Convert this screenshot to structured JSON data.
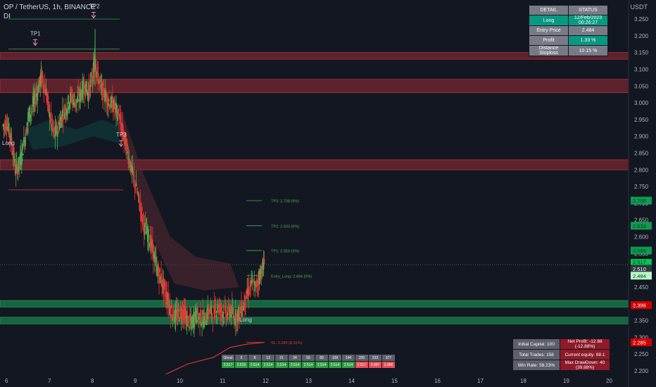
{
  "header": {
    "symbol": "OP / TetherUS, 1h, BINANCE",
    "indicator": "DI"
  },
  "axis_currency": "USDT",
  "price_ticks": [
    "3.250",
    "3.200",
    "3.150",
    "3.100",
    "3.050",
    "3.000",
    "2.950",
    "2.900",
    "2.850",
    "2.800",
    "2.750",
    "2.700",
    "2.650",
    "2.600",
    "2.550",
    "2.500",
    "2.450",
    "2.400",
    "2.350",
    "2.300",
    "2.250",
    "2.200"
  ],
  "time_ticks": [
    "6",
    "7",
    "8",
    "9",
    "10",
    "11",
    "12",
    "13",
    "14",
    "15",
    "16",
    "17",
    "18",
    "19",
    "20"
  ],
  "price_badges": {
    "tp3": "2.708",
    "tp2": "2.633",
    "tp1": "2.559",
    "last": "2.517",
    "last_sub": "33:55",
    "mid": "2.510",
    "entry": "2.484",
    "red": "2.396",
    "sl": "2.285"
  },
  "colors": {
    "bg": "#131722",
    "bull": "#4caf50",
    "bear": "#e53935",
    "bright_green": "#00e676",
    "red_zone": "#9c2b36",
    "green_zone": "#1b8f53",
    "accent_green": "#089981"
  },
  "annotations": {
    "tp1_marker": "TP1",
    "tp2_marker": "TP2",
    "tp3_marker": "TP3",
    "long_left": "Long",
    "long_right": "Long"
  },
  "levels": {
    "tp3_label": "TP3: 2.708 (9%)",
    "tp2_label": "TP2: 2.633 (6%)",
    "tp1_label": "TP1: 2.559 (3%)",
    "entry_label": "Entry_Long: 2.484 (0%)",
    "sl_label": "SL: 2.285 (8.01%)"
  },
  "status_table": {
    "col1": "DETAIL",
    "col2": "STATUS",
    "rows": [
      {
        "k": "Long",
        "v": "12/Feb/2023 00:26:27"
      },
      {
        "k": "Entry Price",
        "v": "2.484"
      },
      {
        "k": "Profit",
        "v": "1.33 %"
      },
      {
        "k": "Distance Stoploss",
        "v": "10.15 %"
      }
    ]
  },
  "fib_table": {
    "head": [
      "Ghost",
      "5",
      "8",
      "13",
      "21",
      "34",
      "55",
      "89",
      "109",
      "144",
      "200",
      "233",
      "377"
    ],
    "vals": [
      "2.517",
      "2.515",
      "2.514",
      "2.514",
      "2.514",
      "2.514",
      "2.514",
      "2.514",
      "2.514",
      "2.514",
      "2.517",
      "2.487",
      "2.486"
    ]
  },
  "stats_table": {
    "initial_capital": "Initial Capital: 100",
    "net_profit": "Net Profit: -12.88 (-12.88%)",
    "total_trades": "Total Trades: 158",
    "current_equity": "Current equity: 88.1",
    "win_rate": "Win Rate: 58.23%",
    "max_drawdown": "Max DrawDown: 40 (39.88%)"
  },
  "chart_data": {
    "type": "candlestick",
    "title": "OP / TetherUS, 1h, BINANCE",
    "ylim": [
      2.2,
      3.29
    ],
    "xlim": [
      5.85,
      20.6
    ],
    "close_path": [
      [
        5.9,
        2.93
      ],
      [
        6.0,
        2.94
      ],
      [
        6.1,
        2.89
      ],
      [
        6.2,
        2.8
      ],
      [
        6.3,
        2.82
      ],
      [
        6.4,
        2.88
      ],
      [
        6.5,
        2.96
      ],
      [
        6.6,
        2.99
      ],
      [
        6.7,
        3.03
      ],
      [
        6.8,
        3.08
      ],
      [
        6.9,
        3.04
      ],
      [
        7.0,
        2.96
      ],
      [
        7.1,
        2.9
      ],
      [
        7.2,
        2.93
      ],
      [
        7.3,
        2.97
      ],
      [
        7.4,
        2.99
      ],
      [
        7.5,
        3.02
      ],
      [
        7.6,
        3.0
      ],
      [
        7.7,
        3.02
      ],
      [
        7.8,
        3.05
      ],
      [
        7.9,
        3.03
      ],
      [
        8.0,
        3.08
      ],
      [
        8.05,
        3.13
      ],
      [
        8.1,
        3.09
      ],
      [
        8.2,
        3.04
      ],
      [
        8.3,
        3.02
      ],
      [
        8.4,
        3.0
      ],
      [
        8.5,
        2.99
      ],
      [
        8.6,
        2.96
      ],
      [
        8.7,
        2.91
      ],
      [
        8.8,
        2.86
      ],
      [
        8.9,
        2.8
      ],
      [
        9.0,
        2.75
      ],
      [
        9.1,
        2.69
      ],
      [
        9.2,
        2.63
      ],
      [
        9.3,
        2.6
      ],
      [
        9.4,
        2.56
      ],
      [
        9.5,
        2.5
      ],
      [
        9.6,
        2.47
      ],
      [
        9.7,
        2.43
      ],
      [
        9.8,
        2.39
      ],
      [
        9.9,
        2.36
      ],
      [
        10.0,
        2.37
      ],
      [
        10.1,
        2.38
      ],
      [
        10.2,
        2.35
      ],
      [
        10.3,
        2.34
      ],
      [
        10.4,
        2.37
      ],
      [
        10.5,
        2.36
      ],
      [
        10.6,
        2.35
      ],
      [
        10.7,
        2.38
      ],
      [
        10.8,
        2.37
      ],
      [
        10.9,
        2.39
      ],
      [
        11.0,
        2.38
      ],
      [
        11.1,
        2.37
      ],
      [
        11.2,
        2.38
      ],
      [
        11.3,
        2.36
      ],
      [
        11.4,
        2.37
      ],
      [
        11.5,
        2.39
      ],
      [
        11.6,
        2.43
      ],
      [
        11.7,
        2.46
      ],
      [
        11.8,
        2.45
      ],
      [
        11.9,
        2.49
      ],
      [
        12.0,
        2.52
      ]
    ],
    "high_labels": {
      "tp2_price": 3.25,
      "tp1_price": 3.16
    },
    "red_zones": [
      [
        3.13,
        3.15
      ],
      [
        3.03,
        3.07
      ],
      [
        2.8,
        2.83
      ]
    ],
    "green_zones": [
      [
        2.39,
        2.41
      ],
      [
        2.34,
        2.36
      ]
    ],
    "sl_line": [
      [
        9.7,
        2.19
      ],
      [
        10.2,
        2.22
      ],
      [
        10.8,
        2.24
      ],
      [
        11.2,
        2.27
      ],
      [
        11.6,
        2.28
      ],
      [
        12.0,
        2.285
      ]
    ]
  }
}
